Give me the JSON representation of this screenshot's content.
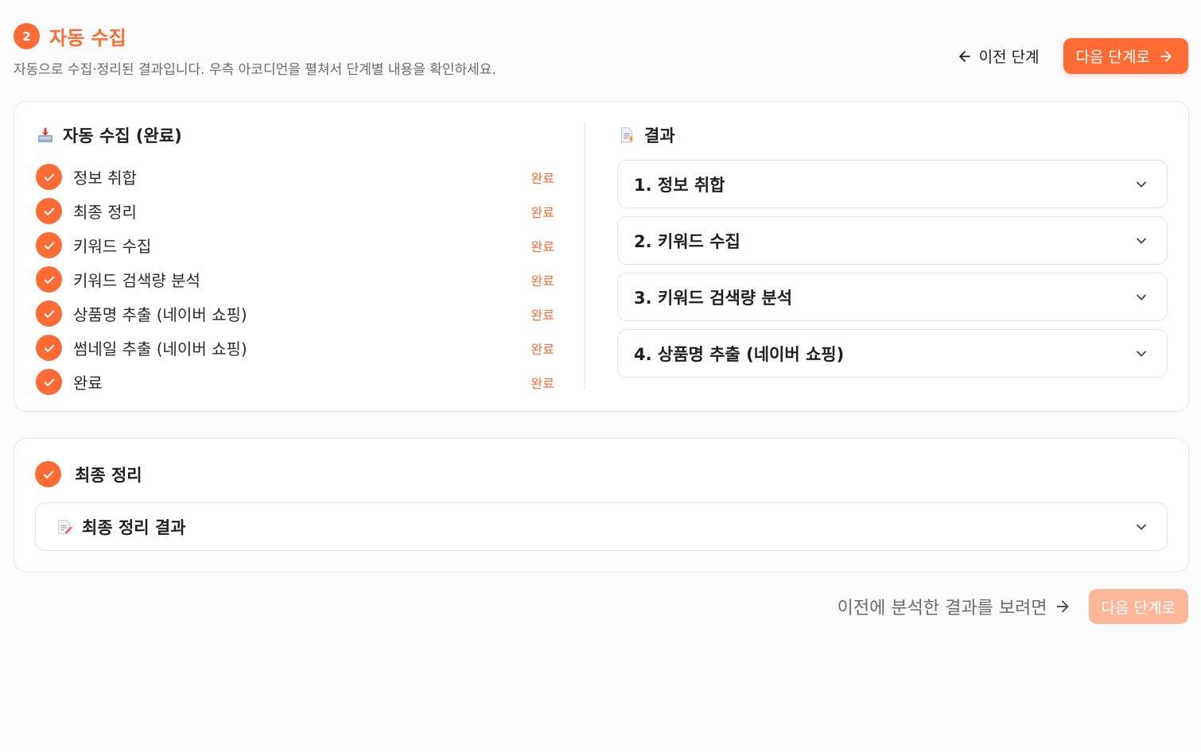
{
  "header": {
    "step_number": "2",
    "step_name": "자동 수집",
    "subtitle": "자동으로 수집·정리된 결과입니다. 우측 아코디언을 펼쳐서 단계별 내용을 확인하세요.",
    "prev_label": "이전 단계",
    "next_label": "다음 단계로"
  },
  "left": {
    "title": "자동 수집 (완료)",
    "icon": "inbox-tray-icon",
    "steps": [
      {
        "label": "정보 취합",
        "status": "완료"
      },
      {
        "label": "최종 정리",
        "status": "완료"
      },
      {
        "label": "키워드 수집",
        "status": "완료"
      },
      {
        "label": "키워드 검색량 분석",
        "status": "완료"
      },
      {
        "label": "상품명 추출 (네이버 쇼핑)",
        "status": "완료"
      },
      {
        "label": "썸네일 추출 (네이버 쇼핑)",
        "status": "완료"
      },
      {
        "label": "완료",
        "status": "완료"
      }
    ]
  },
  "right": {
    "title": "결과",
    "icon": "page-icon",
    "accordions": [
      {
        "label": "1. 정보 취합"
      },
      {
        "label": "2. 키워드 수집"
      },
      {
        "label": "3. 키워드 검색량 분석"
      },
      {
        "label": "4. 상품명 추출 (네이버 쇼핑)"
      }
    ]
  },
  "final": {
    "title": "최종 정리",
    "accordion_label": "최종 정리 결과",
    "accordion_icon": "memo-icon"
  },
  "footer": {
    "text": "이전에 분석한 결과를 보려면",
    "next_label": "다음 단계로"
  },
  "colors": {
    "accent": "#ff6b35",
    "accent_disabled": "#ffb79a",
    "border": "#e6e6e6",
    "muted_text": "#6b6b6b"
  }
}
